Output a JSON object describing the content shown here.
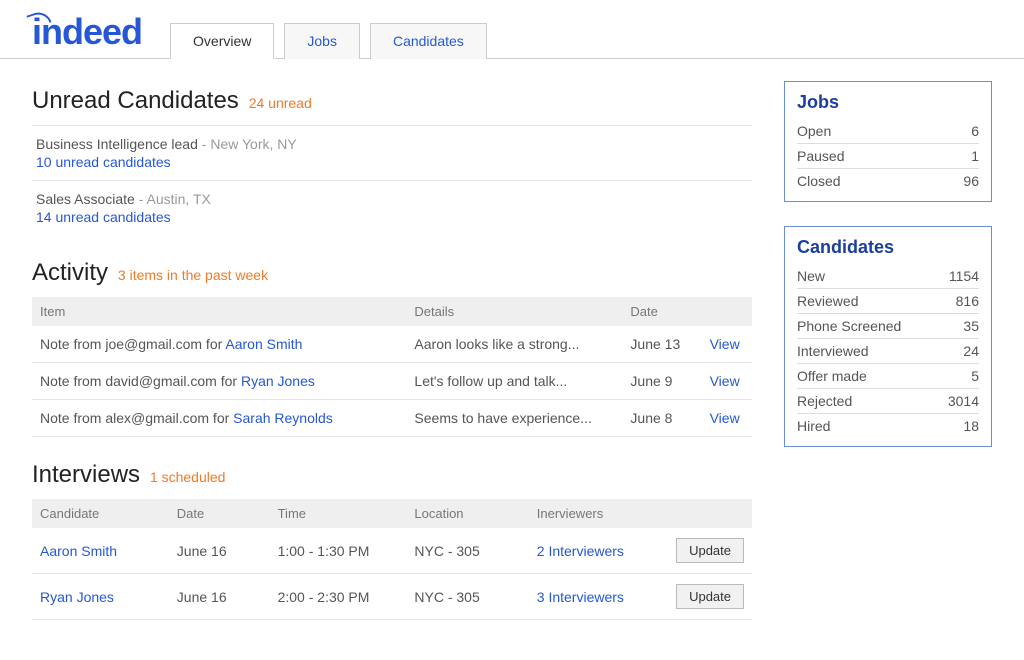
{
  "logo": "indeed",
  "tabs": {
    "overview": "Overview",
    "jobs": "Jobs",
    "candidates": "Candidates"
  },
  "unread": {
    "heading": "Unread Candidates",
    "sub": "24 unread",
    "items": [
      {
        "title": "Business Intelligence lead",
        "location": "New York, NY",
        "link": "10 unread candidates"
      },
      {
        "title": "Sales Associate",
        "location": "Austin, TX",
        "link": "14 unread candidates"
      }
    ]
  },
  "activity": {
    "heading": "Activity",
    "sub": "3 items in the past week",
    "cols": {
      "item": "Item",
      "details": "Details",
      "date": "Date"
    },
    "rows": [
      {
        "prefix": "Note from joe@gmail.com for ",
        "who": "Aaron Smith",
        "details": "Aaron looks like a strong...",
        "date": "June 13",
        "view": "View"
      },
      {
        "prefix": "Note from david@gmail.com for ",
        "who": "Ryan Jones",
        "details": "Let's follow up and talk...",
        "date": "June 9",
        "view": "View"
      },
      {
        "prefix": "Note from alex@gmail.com for ",
        "who": "Sarah Reynolds",
        "details": "Seems to have experience...",
        "date": "June 8",
        "view": "View"
      }
    ]
  },
  "interviews": {
    "heading": "Interviews",
    "sub": "1 scheduled",
    "cols": {
      "candidate": "Candidate",
      "date": "Date",
      "time": "Time",
      "location": "Location",
      "interviewers": "Inerviewers"
    },
    "rows": [
      {
        "candidate": "Aaron Smith",
        "date": "June 16",
        "time": "1:00 - 1:30 PM",
        "location": "NYC - 305",
        "interviewers": "2 Interviewers",
        "update": "Update"
      },
      {
        "candidate": "Ryan Jones",
        "date": "June 16",
        "time": "2:00 - 2:30 PM",
        "location": "NYC - 305",
        "interviewers": "3 Interviewers",
        "update": "Update"
      }
    ]
  },
  "jobs_panel": {
    "heading": "Jobs",
    "rows": [
      {
        "label": "Open",
        "value": "6"
      },
      {
        "label": "Paused",
        "value": "1"
      },
      {
        "label": "Closed",
        "value": "96"
      }
    ]
  },
  "cands_panel": {
    "heading": "Candidates",
    "rows": [
      {
        "label": "New",
        "value": "1154"
      },
      {
        "label": "Reviewed",
        "value": "816"
      },
      {
        "label": "Phone Screened",
        "value": "35"
      },
      {
        "label": "Interviewed",
        "value": "24"
      },
      {
        "label": "Offer made",
        "value": "5"
      },
      {
        "label": "Rejected",
        "value": "3014"
      },
      {
        "label": "Hired",
        "value": "18"
      }
    ]
  }
}
